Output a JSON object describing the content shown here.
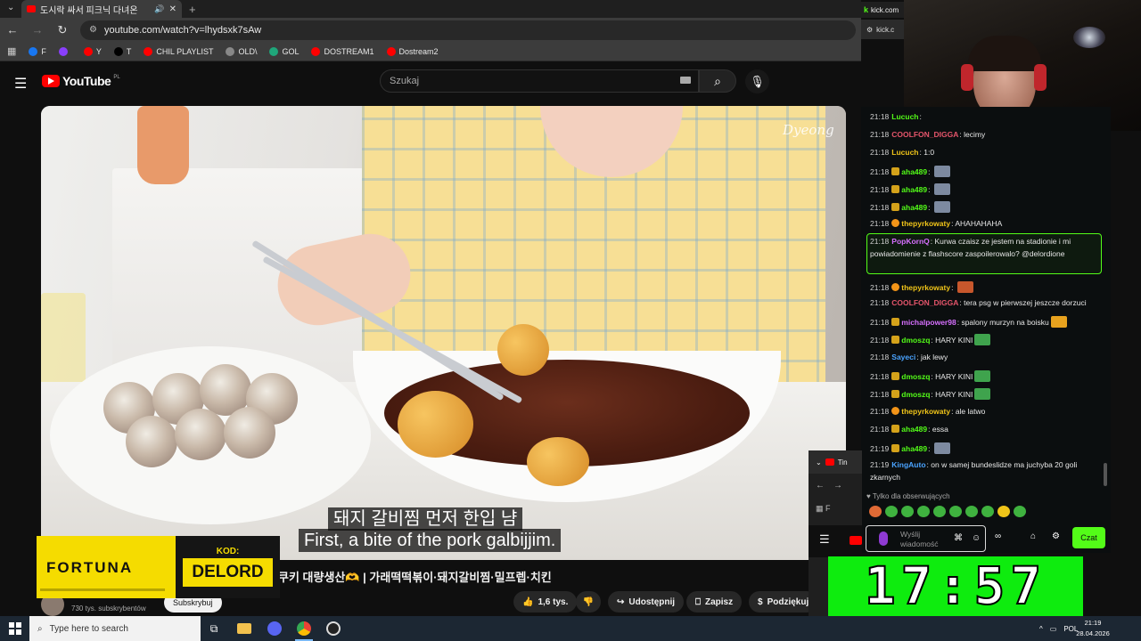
{
  "browser": {
    "tab_title": "도시락 싸서 피크닉 다녀온",
    "url": "youtube.com/watch?v=lhydsxk7sAw",
    "bookmarks": [
      {
        "label": "F",
        "color": "#1877f2"
      },
      {
        "label": "",
        "color": "#8a3ffc"
      },
      {
        "label": "Y",
        "color": "#ff0000"
      },
      {
        "label": "T",
        "color": "#000000"
      },
      {
        "label": "CHIL PLAYLIST",
        "color": "#ff0000"
      },
      {
        "label": "OLD\\",
        "color": "#888888"
      },
      {
        "label": "GOL",
        "color": "#1fa67a"
      },
      {
        "label": "DOSTREAM1",
        "color": "#ff0000"
      },
      {
        "label": "Dostream2",
        "color": "#ff0000"
      }
    ]
  },
  "youtube": {
    "logo": "YouTube",
    "country": "PL",
    "search_placeholder": "Szukaj",
    "video": {
      "watermark": "Dyeong",
      "subtitle_ko": "돼지 갈비찜 먼저 한입 냠",
      "subtitle_en": "First, a bite of the pork galbijjim.",
      "title": "쿠키 대량생산🫶 | 가래떡떡볶이·돼지갈비찜·밀프렙·치킨"
    },
    "channel": {
      "subs": "730 tys. subskrybentów",
      "subscribe": "Subskrybuj"
    },
    "actions": {
      "likes": "1,6 tys.",
      "share": "Udostępnij",
      "save": "Zapisz",
      "thanks": "Podziękuj"
    }
  },
  "fortuna": {
    "brand": "FORTUNA",
    "code_label": "KOD:",
    "code": "DELORD"
  },
  "kick": {
    "tab": "kick.com",
    "url": "kick.c"
  },
  "chat": {
    "messages": [
      {
        "time": "21:18",
        "user": "Lucuch",
        "color": "#53fc18",
        "text": ""
      },
      {
        "time": "21:18",
        "user": "COOLFON_DIGGA",
        "color": "#e5556b",
        "text": "lecimy"
      },
      {
        "time": "21:18",
        "user": "Lucuch",
        "color": "#f0c419",
        "text": "1:0"
      },
      {
        "time": "21:18",
        "user": "aha489",
        "color": "#53fc18",
        "text": ""
      },
      {
        "time": "21:18",
        "user": "aha489",
        "color": "#53fc18",
        "text": ""
      },
      {
        "time": "21:18",
        "user": "aha489",
        "color": "#53fc18",
        "text": ""
      },
      {
        "time": "21:18",
        "user": "thepyrkowaty",
        "color": "#f0c419",
        "text": "AHAHAHAHA"
      },
      {
        "time": "21:18",
        "user": "PopKornQ",
        "color": "#d770ff",
        "text": "Kurwa czaisz ze jestem na stadionie i mi"
      },
      {
        "time": "",
        "user": "",
        "color": "#e8e8e8",
        "text": "powiadomienie z flashscore zaspoilerowalo? @delordione"
      },
      {
        "time": "21:18",
        "user": "thepyrkowaty",
        "color": "#f0c419",
        "text": ""
      },
      {
        "time": "21:18",
        "user": "COOLFON_DIGGA",
        "color": "#e5556b",
        "text": "tera psg w pierwszej jeszcze dorzuci"
      },
      {
        "time": "21:18",
        "user": "michalpower98",
        "color": "#d770ff",
        "text": "spalony murzyn na boisku"
      },
      {
        "time": "21:18",
        "user": "dmoszq",
        "color": "#53fc18",
        "text": "HARY KINI"
      },
      {
        "time": "21:18",
        "user": "Sayeci",
        "color": "#4aa3ff",
        "text": "jak lewy"
      },
      {
        "time": "21:18",
        "user": "dmoszq",
        "color": "#53fc18",
        "text": "HARY KINI"
      },
      {
        "time": "21:18",
        "user": "dmoszq",
        "color": "#53fc18",
        "text": "HARY KINI"
      },
      {
        "time": "21:18",
        "user": "thepyrkowaty",
        "color": "#f0c419",
        "text": "ale latwo"
      },
      {
        "time": "21:18",
        "user": "aha489",
        "color": "#53fc18",
        "text": "essa"
      },
      {
        "time": "21:19",
        "user": "aha489",
        "color": "#53fc18",
        "text": ""
      },
      {
        "time": "21:19",
        "user": "KingAuto",
        "color": "#4aa3ff",
        "text": "on w samej bundeslidze ma juchyba 20 goli"
      },
      {
        "time": "",
        "user": "",
        "color": "#e8e8e8",
        "text": "zkarnych"
      }
    ],
    "follow_note": "Tylko dla obserwujących",
    "input_placeholder": "Wyślij wiadomość",
    "send": "Czat"
  },
  "mini_window": {
    "tab": "Tin",
    "bookmark": "F"
  },
  "timer": "17:57",
  "taskbar": {
    "search": "Type here to search",
    "lang": "POL",
    "time": "21:19",
    "date": "28.04.2026"
  },
  "colors": {
    "kick_green": "#53fc18",
    "yt_red": "#ff0000",
    "fortuna_yellow": "#f5dc00",
    "timer_green": "#0eec0e"
  }
}
